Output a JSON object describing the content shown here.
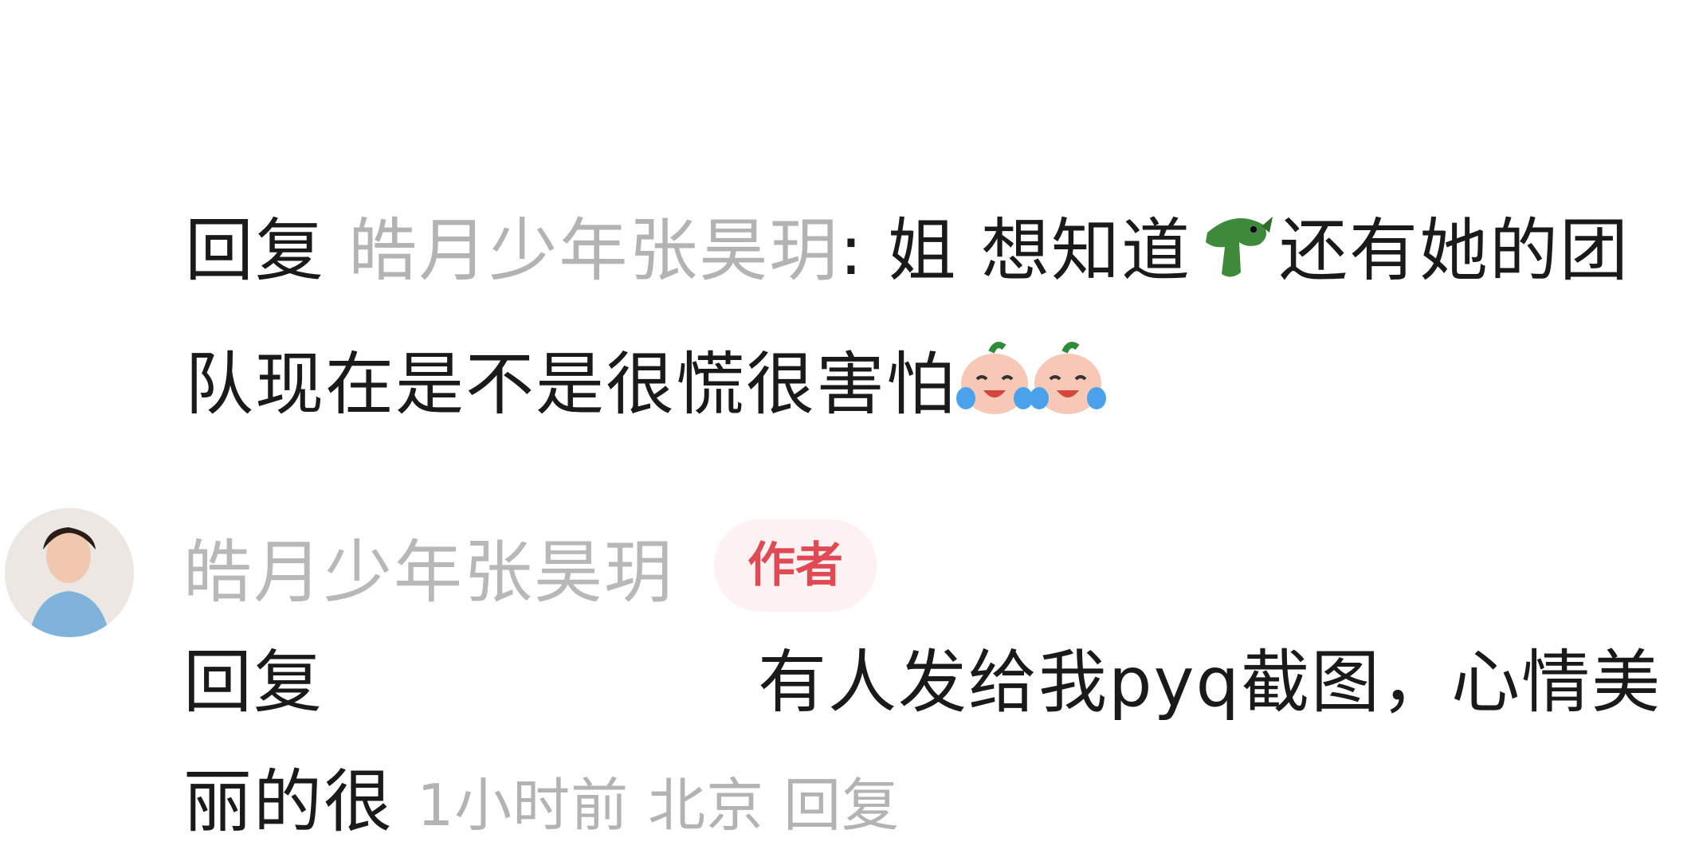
{
  "reply_comment": {
    "reply_label": "回复",
    "reply_to_user": "皓月少年张昊玥",
    "colon": ":",
    "text_part1": "姐 想知道",
    "text_part2": "还有她的团队现在是不是很慌很害怕",
    "emojis": {
      "first": "crocodile-icon",
      "second": "crying-laughing-peach-icon"
    }
  },
  "author_comment": {
    "user_name": "皓月少年张昊玥",
    "badge": "作者",
    "reply_label": "回复",
    "text": "有人发给我pyq截图，心情美丽的很",
    "time": "1小时前",
    "location": "北京",
    "reply_action": "回复"
  },
  "colors": {
    "muted": "#b3b3b3",
    "badge_text": "#e04a54",
    "badge_bg": "#fdf1f1"
  }
}
